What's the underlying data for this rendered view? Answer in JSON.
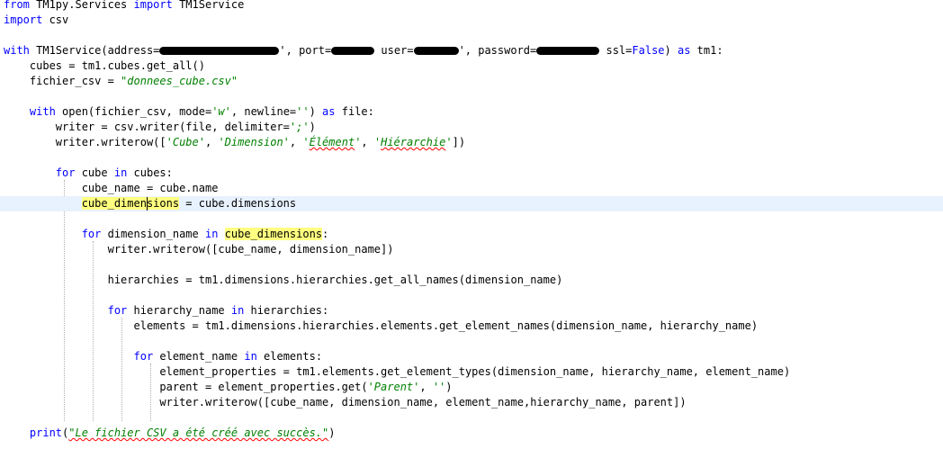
{
  "code": {
    "l1_from": "from",
    "l1_module": " TM1py.Services ",
    "l1_import": "import",
    "l1_name": " TM1Service",
    "l2_import": "import",
    "l2_name": " csv",
    "l4_with": "with",
    "l4_a": " TM1Service(address=",
    "l4_b": "', port=",
    "l4_c": " user=",
    "l4_d": "', password=",
    "l4_e": " ssl=",
    "l4_false": "False",
    "l4_f": ") ",
    "l4_as": "as",
    "l4_g": " tm1:",
    "l5": "    cubes = tm1.cubes.get_all()",
    "l6_a": "    fichier_csv = ",
    "l6_str": "\"donnees_cube.csv\"",
    "l8_indent": "    ",
    "l8_with": "with",
    "l8_a": " open(fichier_csv, mode=",
    "l8_mode": "'w'",
    "l8_b": ", newline=",
    "l8_nl": "''",
    "l8_c": ") ",
    "l8_as": "as",
    "l8_d": " file:",
    "l9_a": "        writer = csv.writer(file, delimiter=",
    "l9_str": "';'",
    "l9_b": ")",
    "l10_a": "        writer.writerow([",
    "l10_s1": "'Cube'",
    "l10_c1": ", ",
    "l10_s2": "'Dimension'",
    "l10_c2": ", ",
    "l10_s3a": "'",
    "l10_s3b": "Élément",
    "l10_s3c": "'",
    "l10_c3": ", ",
    "l10_s4a": "'",
    "l10_s4b": "Hiérarchie",
    "l10_s4c": "'",
    "l10_end": "])",
    "l12_indent": "        ",
    "l12_for": "for",
    "l12_a": " cube ",
    "l12_in": "in",
    "l12_b": " cubes:",
    "l13": "            cube_name = cube.name",
    "l14_indent": "            ",
    "l14_hl": "cube_dimensions",
    "l14_rest": " = cube.dimensions",
    "l16_indent": "            ",
    "l16_for": "for",
    "l16_a": " dimension_name ",
    "l16_in": "in",
    "l16_sp": " ",
    "l16_hl": "cube_dimensions",
    "l16_end": ":",
    "l17": "                writer.writerow([cube_name, dimension_name])",
    "l19": "                hierarchies = tm1.dimensions.hierarchies.get_all_names(dimension_name)",
    "l21_indent": "                ",
    "l21_for": "for",
    "l21_a": " hierarchy_name ",
    "l21_in": "in",
    "l21_b": " hierarchies:",
    "l22": "                    elements = tm1.dimensions.hierarchies.elements.get_element_names(dimension_name, hierarchy_name)",
    "l24_indent": "                    ",
    "l24_for": "for",
    "l24_a": " element_name ",
    "l24_in": "in",
    "l24_b": " elements:",
    "l25": "                        element_properties = tm1.elements.get_element_types(dimension_name, hierarchy_name, element_name)",
    "l26_a": "                        parent = element_properties.get(",
    "l26_str": "'Parent'",
    "l26_b": ", ",
    "l26_empty": "''",
    "l26_c": ")",
    "l27": "                        writer.writerow([cube_name, dimension_name, element_name,hierarchy_name, parent])",
    "l29_indent": "    ",
    "l29_print": "print",
    "l29_a": "(",
    "l29_str": "\"Le fichier CSV a été créé avec succès.\"",
    "l29_b": ")"
  },
  "colors": {
    "keyword": "#0000ff",
    "string": "#008000",
    "highlight": "#ffff80",
    "current_line": "#e8f2fe",
    "squiggle": "#ff0000"
  }
}
